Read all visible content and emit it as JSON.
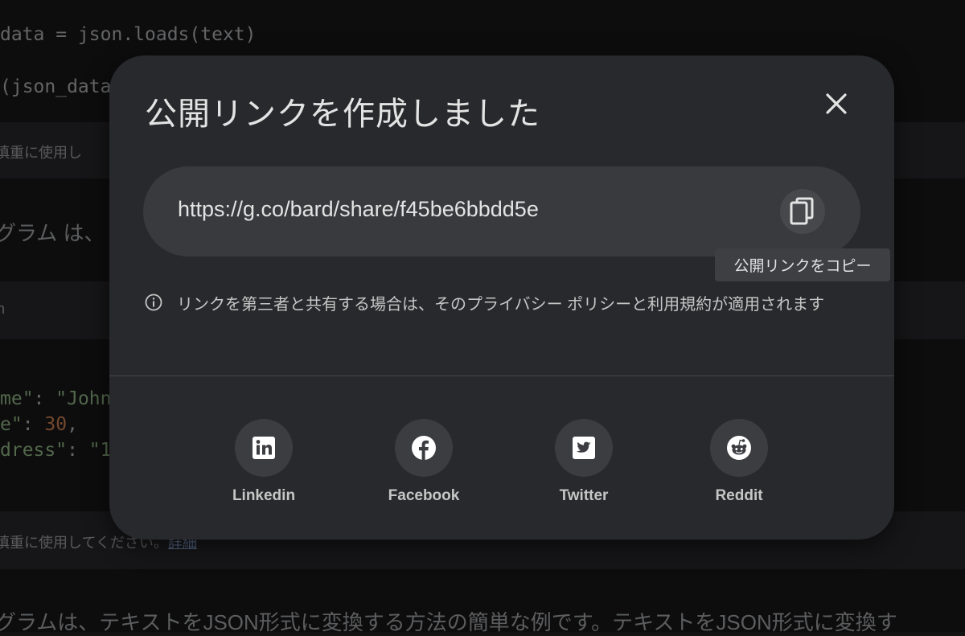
{
  "background": {
    "code_line_1": "data = json.loads(text)",
    "code_line_2": "(json_data",
    "notice_fragment_1": "慎重に使用し",
    "program_fragment": "グラム は、",
    "lang_fragment": "n",
    "code_name_key": "me\"",
    "code_name_value": "\"John",
    "code_age_key": "e\"",
    "code_age_value": "30",
    "code_address_key": "dress\"",
    "code_address_value": "\"1",
    "notice_fragment_2": "慎重に使用してください。",
    "notice_link": "詳細",
    "bottom_text": "グラムは、テキストをJSON形式に変換する方法の簡単な例です。テキストをJSON形式に変換す"
  },
  "dialog": {
    "title": "公開リンクを作成しました",
    "close_icon": "close-icon",
    "link_url": "https://g.co/bard/share/f45be6bbdd5e",
    "copy_icon": "copy-icon",
    "copy_tooltip": "公開リンクをコピー",
    "info_icon": "info-icon",
    "info_text": "リンクを第三者と共有する場合は、そのプライバシー ポリシーと利用規約が適用されます",
    "share_options": [
      {
        "label": "Linkedin",
        "icon": "linkedin-icon"
      },
      {
        "label": "Facebook",
        "icon": "facebook-icon"
      },
      {
        "label": "Twitter",
        "icon": "twitter-icon"
      },
      {
        "label": "Reddit",
        "icon": "reddit-icon"
      }
    ]
  }
}
